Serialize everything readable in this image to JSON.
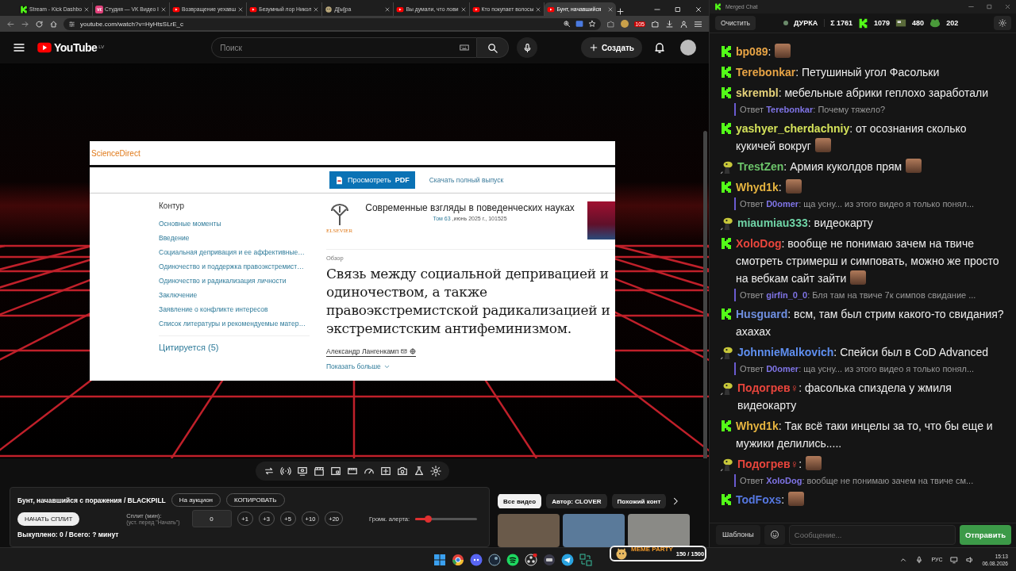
{
  "browser": {
    "tabs": [
      {
        "kind": "kick",
        "title": "Stream - Kick Dashbo",
        "selected": false
      },
      {
        "kind": "vk",
        "title": "Студия — VK Видео I",
        "selected": false
      },
      {
        "kind": "youtube",
        "title": "Возвращение уехавш",
        "selected": false
      },
      {
        "kind": "youtube",
        "title": "Безумный лор Никол",
        "selected": false
      },
      {
        "kind": "generic",
        "title": "Д[ы]ра",
        "selected": false
      },
      {
        "kind": "youtube",
        "title": "Вы думали, что лови",
        "selected": false
      },
      {
        "kind": "youtube",
        "title": "Кто покупает волосы",
        "selected": false
      },
      {
        "kind": "youtube",
        "title": "Бунт, начавшийся",
        "selected": true
      }
    ],
    "url": "youtube.com/watch?v=HyHtsSLrE_c",
    "extension_badge": "105"
  },
  "youtube": {
    "logo": "YouTube",
    "region": "LV",
    "search": {
      "placeholder": "Поиск"
    },
    "create": "Создать"
  },
  "article": {
    "brand": "ScienceDirect",
    "pdf_button": "Просмотреть **PDF**",
    "download_link": "Скачать полный выпуск",
    "outline_title": "Контур",
    "outline": [
      "Основные моменты",
      "Введение",
      "Социальная депривация и ее аффективные…",
      "Одиночество и поддержка правоэкстремист…",
      "Одиночество и радикализация личности",
      "Заключение",
      "Заявление о конфликте интересов",
      "Список литературы и рекомендуемые матер…"
    ],
    "cited": "Цитируется (5)",
    "publisher": "ELSEVIER",
    "journal": "Современные взгляды в поведенческих науках",
    "volume": "Том 63",
    "issue": " ,июнь 2025 г., 101525",
    "type": "Обзор",
    "title": "Связь между социальной депривацией и одиночеством, а также правоэкстремистской радикализацией и экстремистским антифеминизмом.",
    "author": "Александр Лангенкамп",
    "show_more": "Показать больше"
  },
  "panel": {
    "title": "Бунт, начавшийся с поражения / BLACKPILL",
    "auction_button": "На аукцион",
    "copy_button": "КОПИРОВАТЬ",
    "start_button": "НАЧАТЬ СПЛИТ",
    "split_label": "Сплит (мин):",
    "split_hint": "(уст. перед \"Начать\")",
    "split_value": "0",
    "increments": [
      "+1",
      "+3",
      "+5",
      "+10",
      "+20"
    ],
    "alert_label": "Громк. алерта:",
    "alert_volume": {
      "level": 0.2
    },
    "status": "Выкуплено: 0 / Всего: ? минут"
  },
  "suggestions": {
    "chips": [
      {
        "label": "Все видео",
        "selected": true
      },
      {
        "label": "Автор: CLOVER",
        "selected": false
      },
      {
        "label": "Похожий конт",
        "selected": false
      }
    ]
  },
  "overlay": {
    "title": "MEME PARTY",
    "count": "150 / 1500"
  },
  "chat": {
    "window_title": "Merged Chat",
    "clear_button": "Очистить",
    "channel": "ДУРКА",
    "stats": [
      {
        "kind": "sum",
        "value": "Σ 1761"
      },
      {
        "kind": "kick",
        "value": "1079"
      },
      {
        "kind": "emote",
        "value": "480"
      },
      {
        "kind": "frog",
        "value": "202"
      }
    ],
    "messages": [
      {
        "kind": "kick",
        "user": "bp089",
        "color": "#e8a445",
        "text": ":",
        "emote": true
      },
      {
        "kind": "kick",
        "user": "Terebonkar",
        "color": "#e8a445",
        "text": ": Петушиный угол Фасольки",
        "emote": false
      },
      {
        "kind": "kick",
        "user": "skrembl",
        "color": "#e6d27a",
        "text": ": мебельные абрики геплохо заработали",
        "emote": false
      },
      {
        "kind": "kick",
        "user": "yashyer_cherdachniy",
        "color": "#d4e25a",
        "text": ": от осознания сколько кукичей вокруг",
        "emote": true,
        "reply": {
          "prefix": "Ответ",
          "user": "Terebonkar",
          "text": ": Почему тяжело?"
        }
      },
      {
        "kind": "bot",
        "user": "TrestZen",
        "color": "#6cc46a",
        "text": ": Армия куколдов прям",
        "emote": true
      },
      {
        "kind": "kick",
        "user": "Whyd1k",
        "color": "#e6b440",
        "text": ":",
        "emote": true
      },
      {
        "kind": "bot",
        "user": "miaumiau333",
        "color": "#6fd3a6",
        "text": ": видеокарту",
        "emote": false,
        "reply": {
          "prefix": "Ответ",
          "user": "D0omer",
          "text": ": ща усну... из этого видео я только понял..."
        }
      },
      {
        "kind": "kick",
        "user": "XoloDog",
        "color": "#e8453c",
        "text": ": вообще не понимаю зачем на твиче смотреть стримерш и симповать, можно же просто на вебкам сайт зайти",
        "emote": true
      },
      {
        "kind": "kick",
        "user": "Husguard",
        "color": "#6f8fe0",
        "text": ": всм, там был стрим какого-то свидания? ахахах",
        "emote": false,
        "reply": {
          "prefix": "Ответ",
          "user": "girfin_0_0",
          "text": ": Бля там на твиче 7к симпов свидание ..."
        }
      },
      {
        "kind": "bot",
        "user": "JohnnieMalkovich",
        "color": "#5f8ff0",
        "text": ": Спейси был в CoD Advanced",
        "emote": false
      },
      {
        "kind": "bot",
        "user": "Подогрев♀",
        "color": "#e8453c",
        "text": ": фасолька спиздела у жмиля видеокарту",
        "emote": false,
        "reply": {
          "prefix": "Ответ",
          "user": "D0omer",
          "text": ": ща усну... из этого видео я только понял..."
        }
      },
      {
        "kind": "kick",
        "user": "Whyd1k",
        "color": "#e6b440",
        "text": ": Так всё таки инцелы за то, что бы еще и мужики делились.....",
        "emote": false
      },
      {
        "kind": "bot",
        "user": "Подогрев♀",
        "color": "#e8453c",
        "text": ":",
        "emote": true
      },
      {
        "kind": "kick",
        "user": "TodFoxs",
        "color": "#5577e0",
        "text": ":",
        "emote": true,
        "reply": {
          "prefix": "Ответ",
          "user": "XoloDog",
          "text": ": вообще не понимаю зачем на твиче см..."
        }
      }
    ],
    "templates_button": "Шаблоны",
    "input": {
      "placeholder": "Сообщение..."
    },
    "send_button": "Отправить"
  },
  "taskbar": {
    "language": "РУС",
    "time": "15:13",
    "date": "06.08.2026"
  }
}
